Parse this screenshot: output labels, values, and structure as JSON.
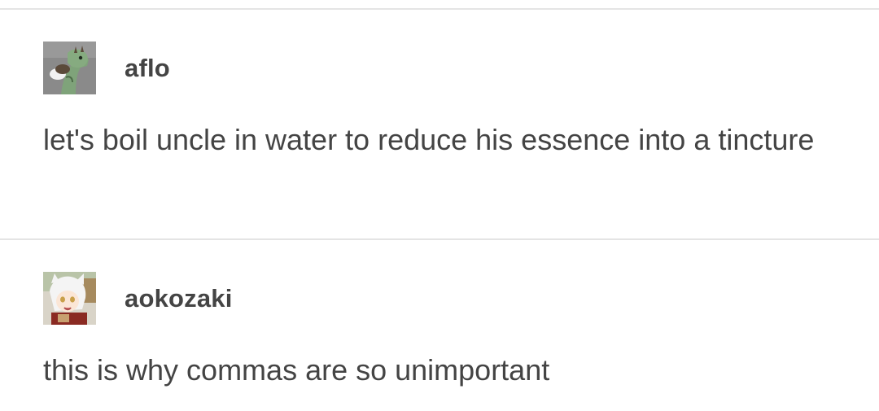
{
  "posts": [
    {
      "username": "aflo",
      "avatar_icon": "giraffe-avatar-icon",
      "text": "let's boil uncle in water to reduce his essence into a tincture"
    },
    {
      "username": "aokozaki",
      "avatar_icon": "anime-girl-avatar-icon",
      "text": "this is why commas are so unimportant"
    }
  ],
  "colors": {
    "text": "#444444",
    "divider": "#e4e4e4",
    "background": "#ffffff"
  }
}
